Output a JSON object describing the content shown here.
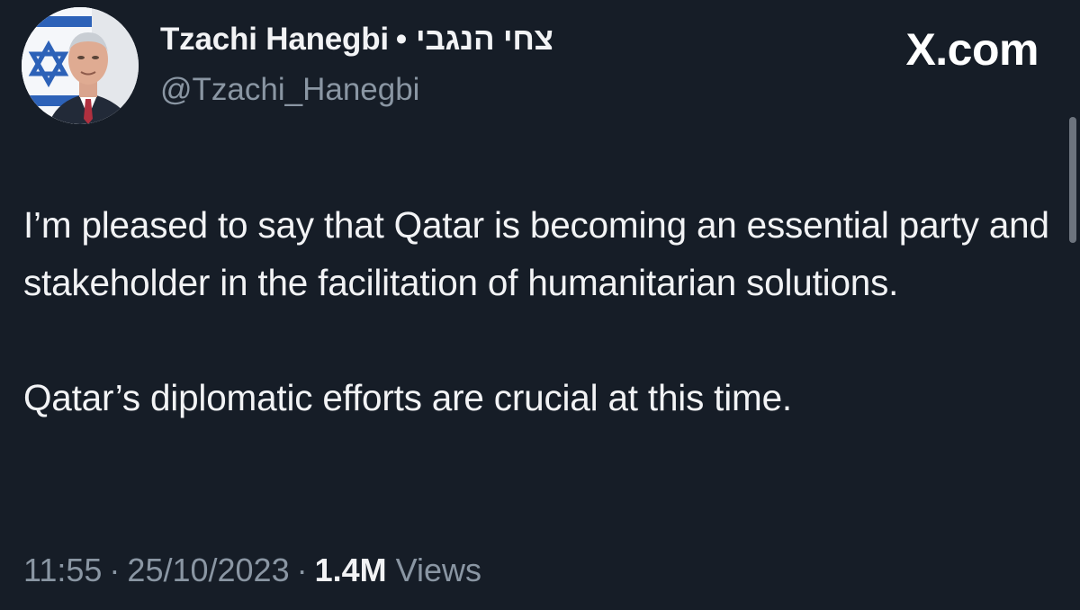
{
  "author": {
    "display_name": "Tzachi Hanegbi",
    "separator": "•",
    "hebrew_name": "צחי הנגבי",
    "handle": "@Tzachi_Hanegbi",
    "avatar_icon": "profile-photo"
  },
  "brand": {
    "label": "X.com"
  },
  "tweet": {
    "paragraphs": [
      "I’m pleased to say that Qatar is becoming an essential party and stakeholder in the facilitation of humanitarian solutions.",
      "Qatar’s diplomatic efforts are crucial at this time."
    ]
  },
  "meta": {
    "time": "11:55",
    "date": "25/10/2023",
    "dot": "·",
    "views_count": "1.4M",
    "views_label": "Views"
  },
  "colors": {
    "background": "#161d27",
    "primary_text": "#f2f3f5",
    "secondary_text": "#8a96a3"
  }
}
